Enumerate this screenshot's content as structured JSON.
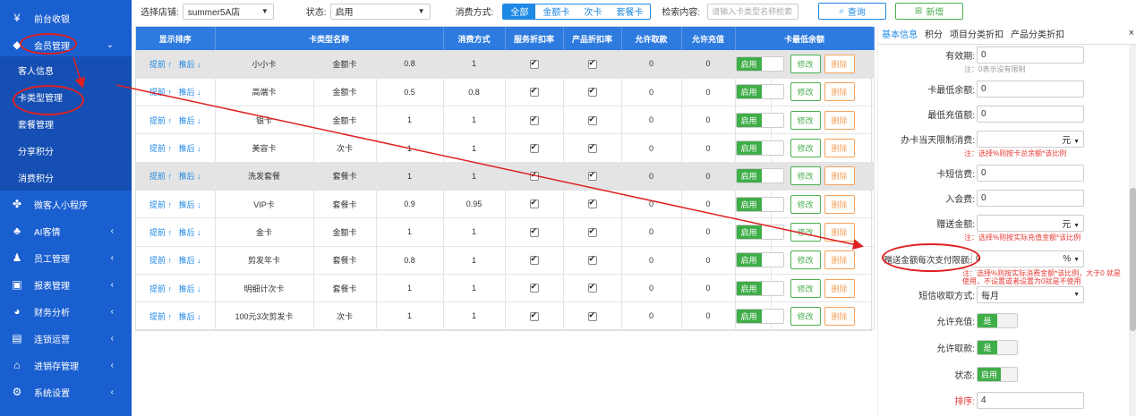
{
  "sidebar": {
    "items": [
      {
        "label": "前台收银",
        "icon": "cash-register-icon",
        "glyph": "¥",
        "arrow": ""
      },
      {
        "label": "会员管理",
        "icon": "diamond-icon",
        "glyph": "◆",
        "arrow": "⌄"
      },
      {
        "label": "微客人小程序",
        "icon": "miniprogram-icon",
        "glyph": "✤",
        "arrow": ""
      },
      {
        "label": "AI客情",
        "icon": "ai-user-icon",
        "glyph": "♣",
        "arrow": "‹"
      },
      {
        "label": "员工管理",
        "icon": "staff-icon",
        "glyph": "♟",
        "arrow": "‹"
      },
      {
        "label": "报表管理",
        "icon": "report-icon",
        "glyph": "▣",
        "arrow": "‹"
      },
      {
        "label": "财务分析",
        "icon": "pie-chart-icon",
        "glyph": "◕",
        "arrow": "‹"
      },
      {
        "label": "连锁运营",
        "icon": "chain-icon",
        "glyph": "▤",
        "arrow": "‹"
      },
      {
        "label": "进销存管理",
        "icon": "warehouse-icon",
        "glyph": "⌂",
        "arrow": "‹"
      },
      {
        "label": "系统设置",
        "icon": "gear-icon",
        "glyph": "⚙",
        "arrow": "‹"
      }
    ],
    "sub_items": [
      "客人信息",
      "卡类型管理",
      "套餐管理",
      "分享积分",
      "消费积分"
    ]
  },
  "toolbar": {
    "store_label": "选择店铺:",
    "store_value": "summer5A店",
    "status_label": "状态:",
    "status_value": "启用",
    "consume_label": "消费方式:",
    "tabs": [
      "全部",
      "金额卡",
      "次卡",
      "套餐卡"
    ],
    "search_label": "检索内容:",
    "search_placeholder": "请输入卡类型名称检索",
    "query_label": "查询",
    "add_label": "新增"
  },
  "table": {
    "headers": [
      "显示排序",
      "卡类型名称",
      "消费方式",
      "服务折扣率",
      "产品折扣率",
      "允许取款",
      "允许充值",
      "卡最低余额"
    ],
    "sort_up": "提前",
    "sort_down": "推后",
    "enable_label": "启用",
    "edit_label": "修改",
    "delete_label": "删除",
    "rows": [
      {
        "name": "小小卡",
        "type": "金额卡",
        "service": "0.8",
        "product": "1",
        "withdraw": "0",
        "min_balance": "0",
        "shaded": true
      },
      {
        "name": "高端卡",
        "type": "金额卡",
        "service": "0.5",
        "product": "0.8",
        "withdraw": "0",
        "min_balance": "0",
        "shaded": false
      },
      {
        "name": "银卡",
        "type": "金额卡",
        "service": "1",
        "product": "1",
        "withdraw": "0",
        "min_balance": "0",
        "shaded": false
      },
      {
        "name": "美容卡",
        "type": "次卡",
        "service": "1",
        "product": "1",
        "withdraw": "0",
        "min_balance": "0",
        "shaded": false
      },
      {
        "name": "洗发套餐",
        "type": "套餐卡",
        "service": "1",
        "product": "1",
        "withdraw": "0",
        "min_balance": "0",
        "shaded": true
      },
      {
        "name": "VIP卡",
        "type": "套餐卡",
        "service": "0.9",
        "product": "0.95",
        "withdraw": "0",
        "min_balance": "0",
        "shaded": false
      },
      {
        "name": "金卡",
        "type": "金额卡",
        "service": "1",
        "product": "1",
        "withdraw": "0",
        "min_balance": "0",
        "shaded": false
      },
      {
        "name": "剪发年卡",
        "type": "套餐卡",
        "service": "0.8",
        "product": "1",
        "withdraw": "0",
        "min_balance": "0",
        "shaded": false
      },
      {
        "name": "明细计次卡",
        "type": "套餐卡",
        "service": "1",
        "product": "1",
        "withdraw": "0",
        "min_balance": "0",
        "shaded": false
      },
      {
        "name": "100元3次剪发卡",
        "type": "次卡",
        "service": "1",
        "product": "1",
        "withdraw": "0",
        "min_balance": "0",
        "shaded": false
      }
    ]
  },
  "panel": {
    "tabs": [
      "基本信息",
      "积分",
      "项目分类折扣",
      "产品分类折扣"
    ],
    "close": "×",
    "fields": {
      "validity_label": "有效期:",
      "validity_value": "0",
      "validity_note": "注：0表示没有限制",
      "min_balance_label": "卡最低余额:",
      "min_balance_value": "0",
      "min_recharge_label": "最低充值额:",
      "min_recharge_value": "0",
      "daily_limit_label": "办卡当天限制消费:",
      "daily_limit_unit": "元",
      "daily_limit_note": "注：选择%则按卡总余额*该比例",
      "sms_fee_label": "卡短信费:",
      "sms_fee_value": "0",
      "join_fee_label": "入会费:",
      "join_fee_value": "0",
      "gift_amount_label": "赠送金额:",
      "gift_amount_unit": "元",
      "gift_amount_note": "注：选择%则按实际充值金额*该比例",
      "gift_limit_label": "赠送金额每次支付限额:",
      "gift_limit_value": "0",
      "gift_limit_unit": "%",
      "gift_limit_note1": "注：选择%则按实际消费金额*该比例，大于0 就是",
      "gift_limit_note2": "使用，不设置或者设置为0就是不使用",
      "sms_mode_label": "短信收取方式:",
      "sms_mode_value": "每月",
      "allow_recharge_label": "允许充值:",
      "allow_recharge_value": "是",
      "allow_withdraw_label": "允许取款:",
      "allow_withdraw_value": "是",
      "status_label": "状态:",
      "status_value": "启用",
      "order_label": "排序:",
      "order_value": "4"
    }
  }
}
